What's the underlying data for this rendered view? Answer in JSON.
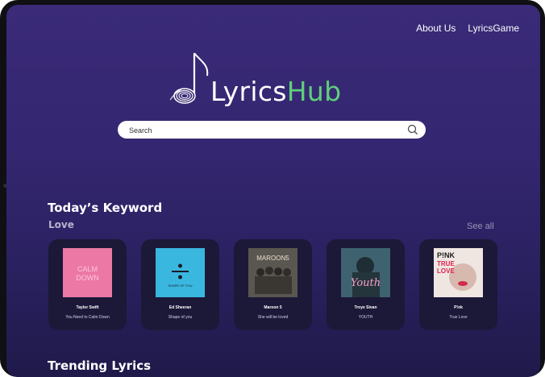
{
  "nav": {
    "about": "About Us",
    "game": "LyricsGame"
  },
  "logo": {
    "word1": "Lyrics",
    "word2": "Hub"
  },
  "search": {
    "placeholder": "Search"
  },
  "keyword_section": {
    "title": "Today’s Keyword",
    "keyword": "Love",
    "see_all": "See all"
  },
  "cards": [
    {
      "artist": "Taylor Swift",
      "song": "You Need to Calm Down",
      "cover_text": "CALM DOWN"
    },
    {
      "artist": "Ed Sheeran",
      "song": "Shape of you",
      "cover_text": "SHAPE OF YOU"
    },
    {
      "artist": "Maroon 5",
      "song": "She will be loved",
      "cover_text": "MAROON5"
    },
    {
      "artist": "Troye Sivan",
      "song": "YOUTH",
      "cover_text": "Youth"
    },
    {
      "artist": "P!nk",
      "song": "True Love",
      "cover_text": "P!NK TRUE LOVE"
    }
  ],
  "trending": {
    "title": "Trending Lyrics"
  },
  "colors": {
    "accent_green": "#5fcf7a",
    "background": "#3a2a78",
    "card": "#1c1838"
  },
  "icons": {
    "search": "search-icon",
    "logo": "music-note-logo-icon"
  }
}
